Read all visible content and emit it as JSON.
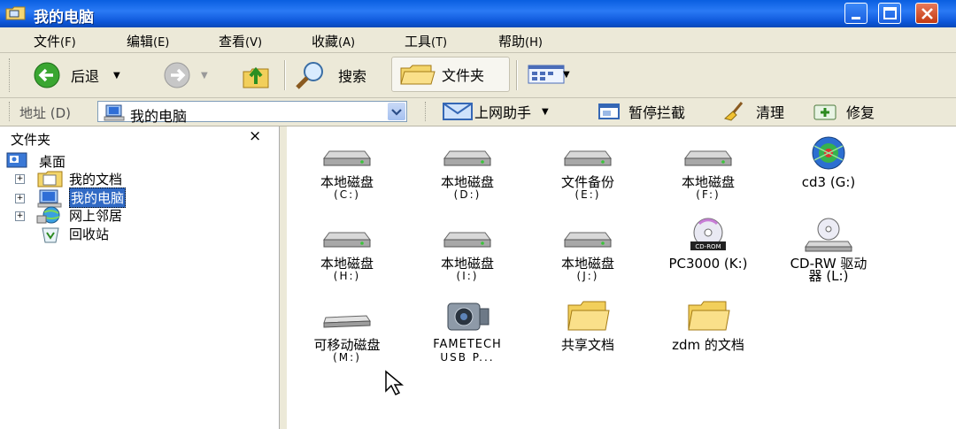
{
  "window": {
    "title": "我的电脑"
  },
  "menubar": {
    "items": [
      {
        "label": "文件",
        "hotkey": "(F)"
      },
      {
        "label": "编辑",
        "hotkey": "(E)"
      },
      {
        "label": "查看",
        "hotkey": "(V)"
      },
      {
        "label": "收藏",
        "hotkey": "(A)"
      },
      {
        "label": "工具",
        "hotkey": "(T)"
      },
      {
        "label": "帮助",
        "hotkey": "(H)"
      }
    ]
  },
  "toolbar": {
    "back_label": "后退",
    "search_label": "搜索",
    "folders_label": "文件夹"
  },
  "addressbar": {
    "label": "地址 (D)",
    "value": "我的电脑",
    "links": [
      {
        "label": "上网助手"
      },
      {
        "label": "暂停拦截"
      },
      {
        "label": "清理"
      },
      {
        "label": "修复"
      }
    ]
  },
  "folders_pane": {
    "title": "文件夹",
    "close": "×",
    "root": "桌面",
    "items": [
      "我的文档",
      "我的电脑",
      "网上邻居",
      "回收站"
    ]
  },
  "drives": [
    {
      "name": "本地磁盘",
      "letter": "(C:)",
      "icon": "hard-disk-icon"
    },
    {
      "name": "本地磁盘",
      "letter": "(D:)",
      "icon": "hard-disk-icon"
    },
    {
      "name": "文件备份",
      "letter": "(E:)",
      "icon": "hard-disk-icon"
    },
    {
      "name": "本地磁盘",
      "letter": "(F:)",
      "icon": "hard-disk-icon"
    },
    {
      "name": "cd3  (G:)",
      "letter": "",
      "icon": "cd-custom-icon"
    },
    {
      "name": "本地磁盘",
      "letter": "(H:)",
      "icon": "hard-disk-icon"
    },
    {
      "name": "本地磁盘",
      "letter": "(I:)",
      "icon": "hard-disk-icon"
    },
    {
      "name": "本地磁盘",
      "letter": "(J:)",
      "icon": "hard-disk-icon"
    },
    {
      "name": "PC3000  (K:)",
      "letter": "",
      "icon": "cd-rom-icon"
    },
    {
      "name": "CD-RW 驱动",
      "letter": "器 (L:)",
      "icon": "cd-rw-drive-icon"
    },
    {
      "name": "可移动磁盘",
      "letter": "(M:)",
      "icon": "removable-disk-icon"
    },
    {
      "name": "FAMETECH",
      "letter": "USB P...",
      "icon": "camera-icon"
    },
    {
      "name": "共享文档",
      "letter": "",
      "icon": "folder-icon"
    },
    {
      "name": "zdm 的文档",
      "letter": "",
      "icon": "folder-icon"
    }
  ]
}
